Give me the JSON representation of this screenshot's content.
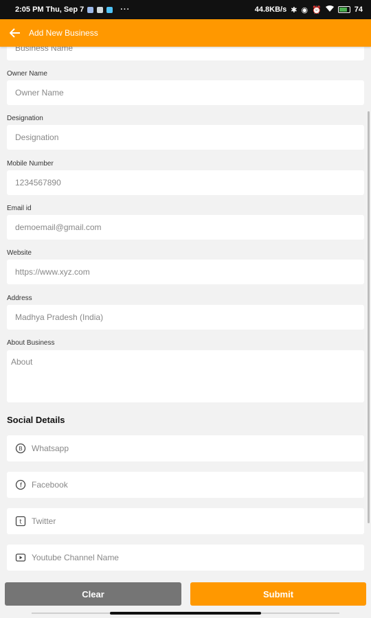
{
  "status_bar": {
    "time_date": "2:05 PM Thu, Sep 7",
    "more": "···",
    "network_speed": "44.8KB/s",
    "battery": "74"
  },
  "app_bar": {
    "title": "Add New Business"
  },
  "form": {
    "business_name": {
      "placeholder": "Business Name"
    },
    "owner_name": {
      "label": "Owner Name",
      "placeholder": "Owner Name"
    },
    "designation": {
      "label": "Designation",
      "placeholder": "Designation"
    },
    "mobile": {
      "label": "Mobile Number",
      "placeholder": "1234567890"
    },
    "email": {
      "label": "Email id",
      "placeholder": "demoemail@gmail.com"
    },
    "website": {
      "label": "Website",
      "placeholder": "https://www.xyz.com"
    },
    "address": {
      "label": "Address",
      "placeholder": "Madhya Pradesh (India)"
    },
    "about": {
      "label": "About Business",
      "placeholder": "About"
    }
  },
  "social": {
    "title": "Social Details",
    "whatsapp": {
      "placeholder": "Whatsapp",
      "icon": "whatsapp-icon"
    },
    "facebook": {
      "placeholder": "Facebook",
      "icon": "facebook-icon"
    },
    "twitter": {
      "placeholder": "Twitter",
      "icon": "twitter-icon"
    },
    "youtube": {
      "placeholder": "Youtube Channel Name",
      "icon": "youtube-icon"
    }
  },
  "buttons": {
    "clear": "Clear",
    "submit": "Submit"
  },
  "colors": {
    "accent": "#ff9800",
    "clear_button": "#757575",
    "background": "#f2f2f2"
  }
}
